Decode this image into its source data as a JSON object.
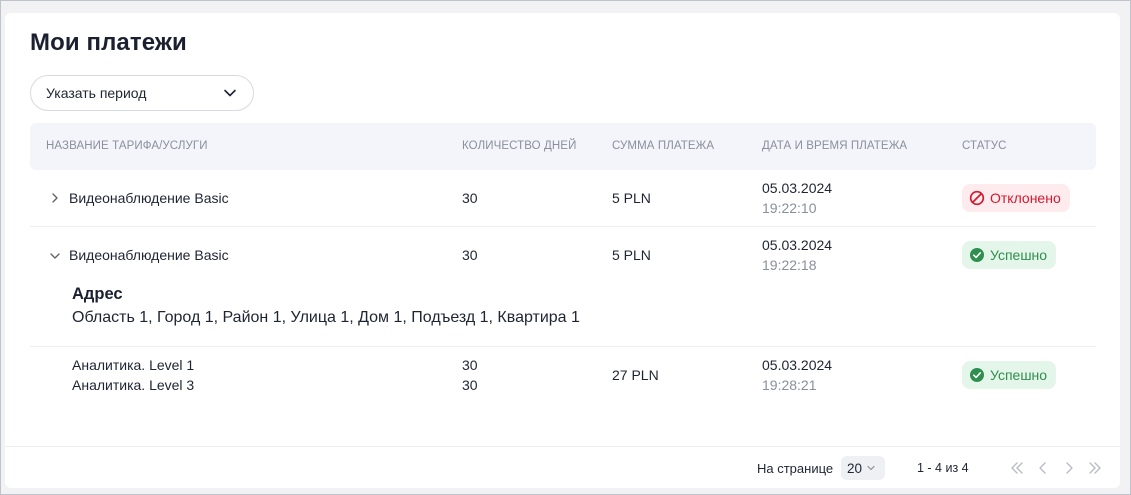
{
  "page": {
    "title": "Мои платежи"
  },
  "filter": {
    "period_label": "Указать период"
  },
  "table": {
    "headers": [
      "НАЗВАНИЕ ТАРИФА/УСЛУГИ",
      "КОЛИЧЕСТВО ДНЕЙ",
      "СУММА ПЛАТЕЖА",
      "ДАТА И ВРЕМЯ ПЛАТЕЖА",
      "СТАТУС"
    ],
    "rows": [
      {
        "name": "Видеонаблюдение Basic",
        "days": "30",
        "sum": "5 PLN",
        "date": "05.03.2024",
        "time": "19:22:10",
        "status": "Отклонено",
        "status_type": "error",
        "expanded": false
      },
      {
        "name": "Видеонаблюдение Basic",
        "days": "30",
        "sum": "5 PLN",
        "date": "05.03.2024",
        "time": "19:22:18",
        "status": "Успешно",
        "status_type": "success",
        "expanded": true,
        "details": {
          "title": "Адрес",
          "value": "Область 1, Город 1, Район 1, Улица 1, Дом 1, Подъезд 1, Квартира 1"
        }
      },
      {
        "items": [
          "Аналитика. Level 1",
          "Аналитика. Level 3"
        ],
        "days": [
          "30",
          "30"
        ],
        "sum": "27 PLN",
        "date": "05.03.2024",
        "time": "19:28:21",
        "status": "Успешно",
        "status_type": "success"
      }
    ]
  },
  "pagination": {
    "per_page_label": "На странице",
    "per_page_value": "20",
    "range": "1 - 4 из 4"
  },
  "colors": {
    "error": "#d3192f",
    "success": "#2f8f4e",
    "header_bg": "#f4f5fa"
  }
}
